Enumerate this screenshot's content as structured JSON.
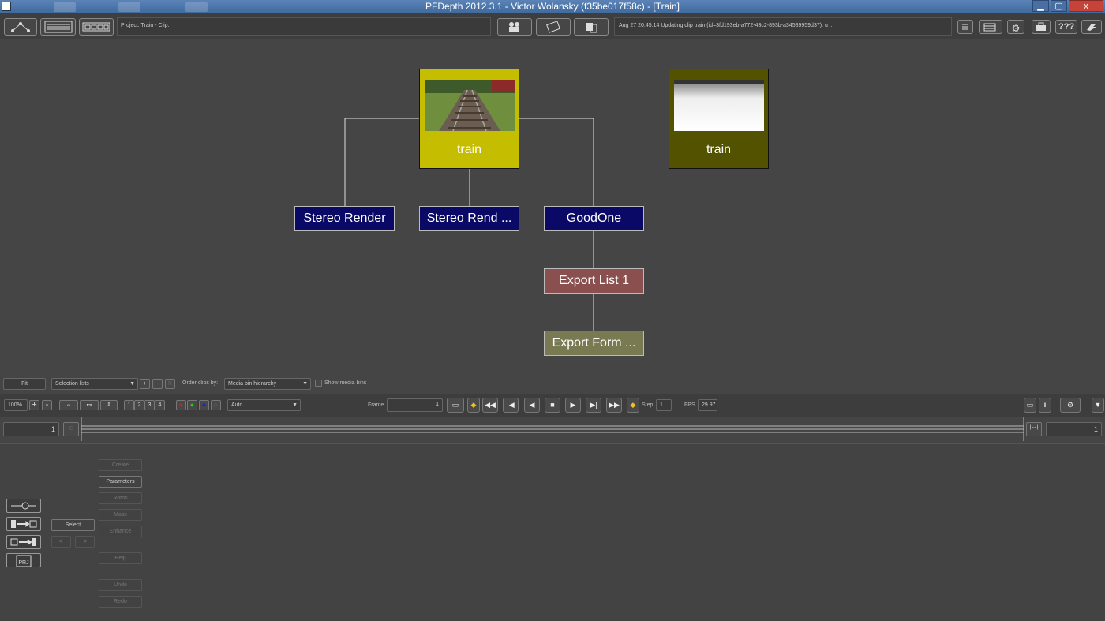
{
  "window": {
    "title": "PFDepth 2012.3.1 - Victor Wolansky (f35be017f58c) - [Train]",
    "close": "x"
  },
  "toolbar": {
    "project": "Project: Train - Clip:",
    "status": "Aug 27 20:45:14 Updating clip train (id=3fd193eb-a772-43c2-893b-a34589959d37): u ...",
    "help_label": "???"
  },
  "graph": {
    "clips": [
      {
        "label": "train",
        "color": "#c4bd00",
        "thumb": "rail"
      },
      {
        "label": "train",
        "color": "#525200",
        "thumb": "depth"
      }
    ],
    "nodes": [
      {
        "label": "Stereo Render",
        "color": "#0a0a66"
      },
      {
        "label": "Stereo Rend ...",
        "color": "#0a0a66"
      },
      {
        "label": "GoodOne",
        "color": "#0a0a66"
      },
      {
        "label": "Export List 1",
        "color": "#8a4f4f"
      },
      {
        "label": "Export Form ...",
        "color": "#7a7a52"
      }
    ]
  },
  "bin": {
    "fit": "Fit",
    "selection": "Selection lists",
    "plus": "+",
    "minus": "-",
    "r": "R",
    "order_label": "Order clips by:",
    "order_value": "Media bin hierarchy",
    "show_bins": "Show media bins"
  },
  "viewer": {
    "zoom": "100%",
    "plus": "+",
    "minus": "-",
    "views": [
      "1",
      "2",
      "3",
      "4"
    ],
    "mode": "Auto",
    "frame_label": "Frame",
    "frame_value": "1",
    "step_label": "Step",
    "step_value": "1",
    "fps_label": "FPS",
    "fps_value": "29.97",
    "info": "i"
  },
  "timeline": {
    "start": "1",
    "end": "1",
    "c": "C"
  },
  "panel": {
    "select": "Select",
    "left_arrow": "<-",
    "right_arrow": "->",
    "create": "Create",
    "parameters": "Parameters",
    "rotos": "Rotos",
    "mask": "Mask",
    "enhance": "Enhance",
    "help": "Help",
    "undo": "Undo",
    "redo": "Redo",
    "project_icon_text": "PRJ"
  }
}
